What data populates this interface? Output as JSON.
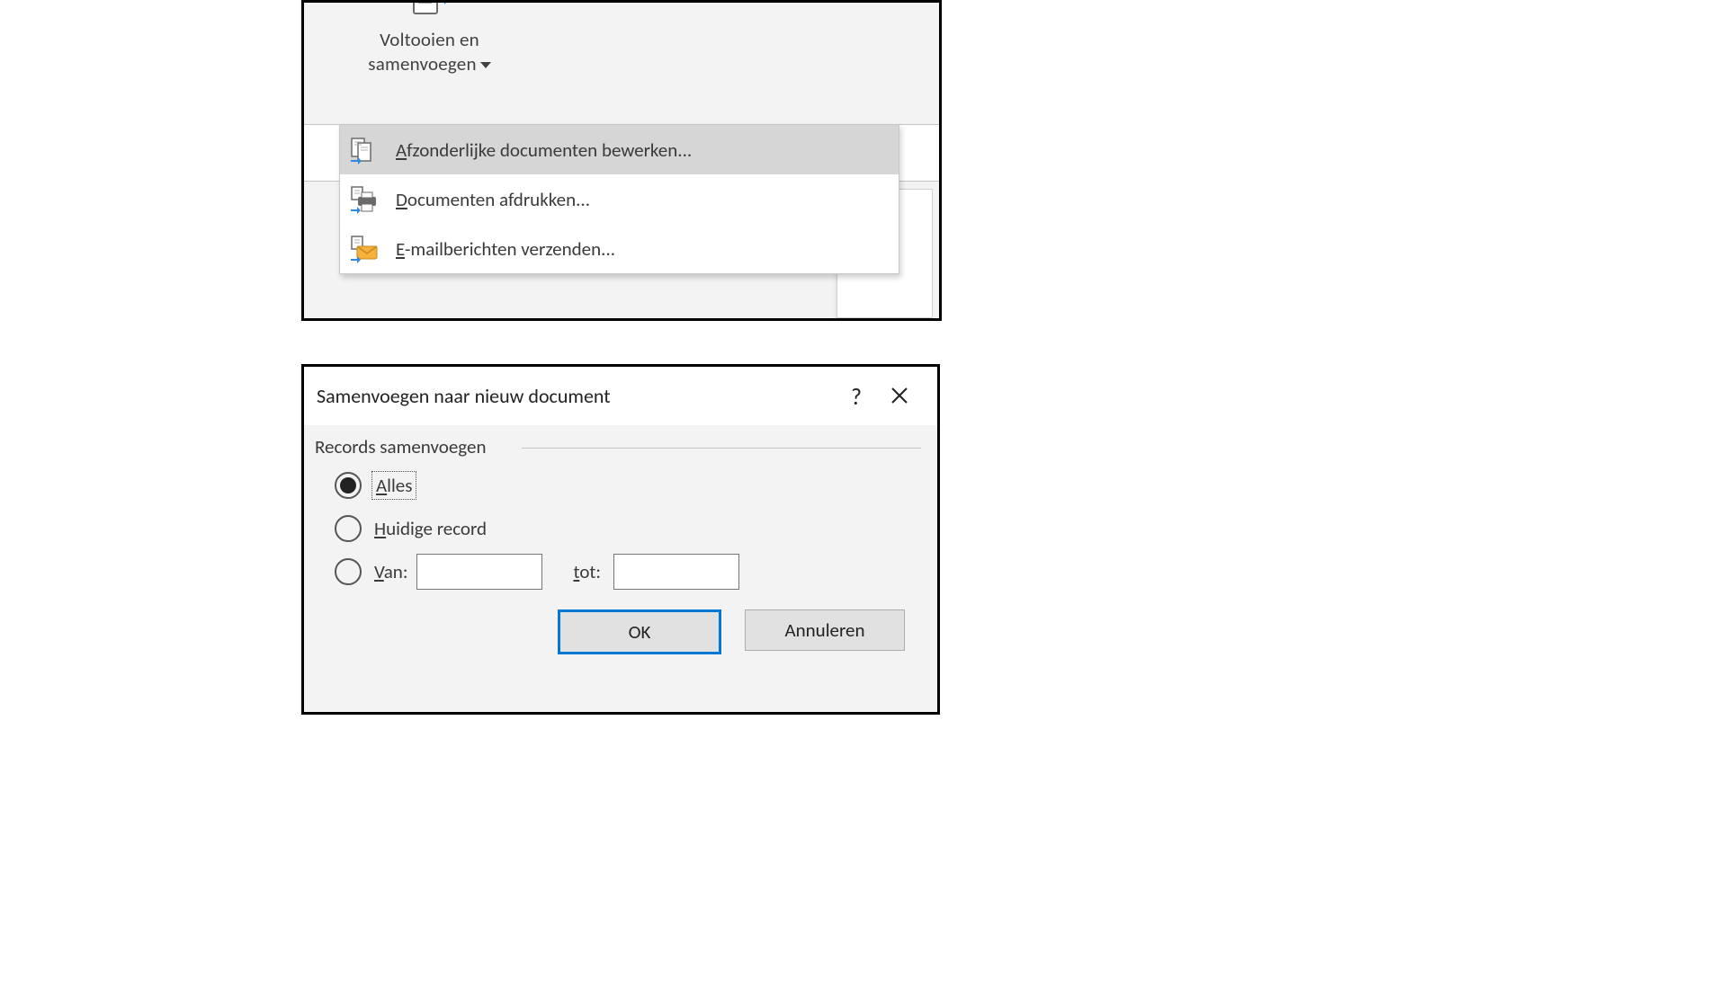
{
  "ribbon": {
    "button_line1": "Voltooien en",
    "button_line2": "samenvoegen"
  },
  "menu": {
    "items": [
      {
        "mnemonic": "A",
        "rest": "fzonderlijke documenten bewerken...",
        "icon": "edit-documents-icon"
      },
      {
        "mnemonic": "D",
        "rest": "ocumenten afdrukken...",
        "icon": "print-documents-icon"
      },
      {
        "mnemonic": "E",
        "rest": "-mailberichten verzenden...",
        "icon": "send-email-icon"
      }
    ]
  },
  "dialog": {
    "title": "Samenvoegen naar nieuw document",
    "help": "?",
    "group_label": "Records samenvoegen",
    "radios": {
      "all": {
        "mnemonic": "A",
        "rest": "lles"
      },
      "current": {
        "mnemonic": "H",
        "rest": "uidige record"
      },
      "from": {
        "mnemonic": "V",
        "rest": "an:"
      }
    },
    "to_label_underline": "t",
    "to_label_rest": "ot:",
    "from_value": "",
    "to_value": "",
    "ok": "OK",
    "cancel": "Annuleren"
  }
}
